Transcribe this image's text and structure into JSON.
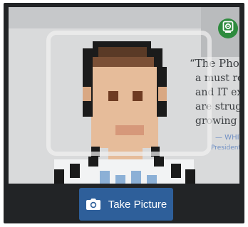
{
  "camera": {
    "poster_text_lines": [
      "“The Phoenix",
      "a must read",
      "and IT exec",
      "are struggl",
      "growing c"
    ],
    "poster_attribution": [
      "— WHITER",
      "President and"
    ]
  },
  "controls": {
    "switch_camera_icon": "camera-switch-icon",
    "take_picture_label": "Take Picture",
    "take_picture_icon": "camera-icon"
  },
  "colors": {
    "frame_bg": "#222426",
    "button_bg": "#2e5f9a",
    "switch_bg": "#2e8b3e"
  }
}
